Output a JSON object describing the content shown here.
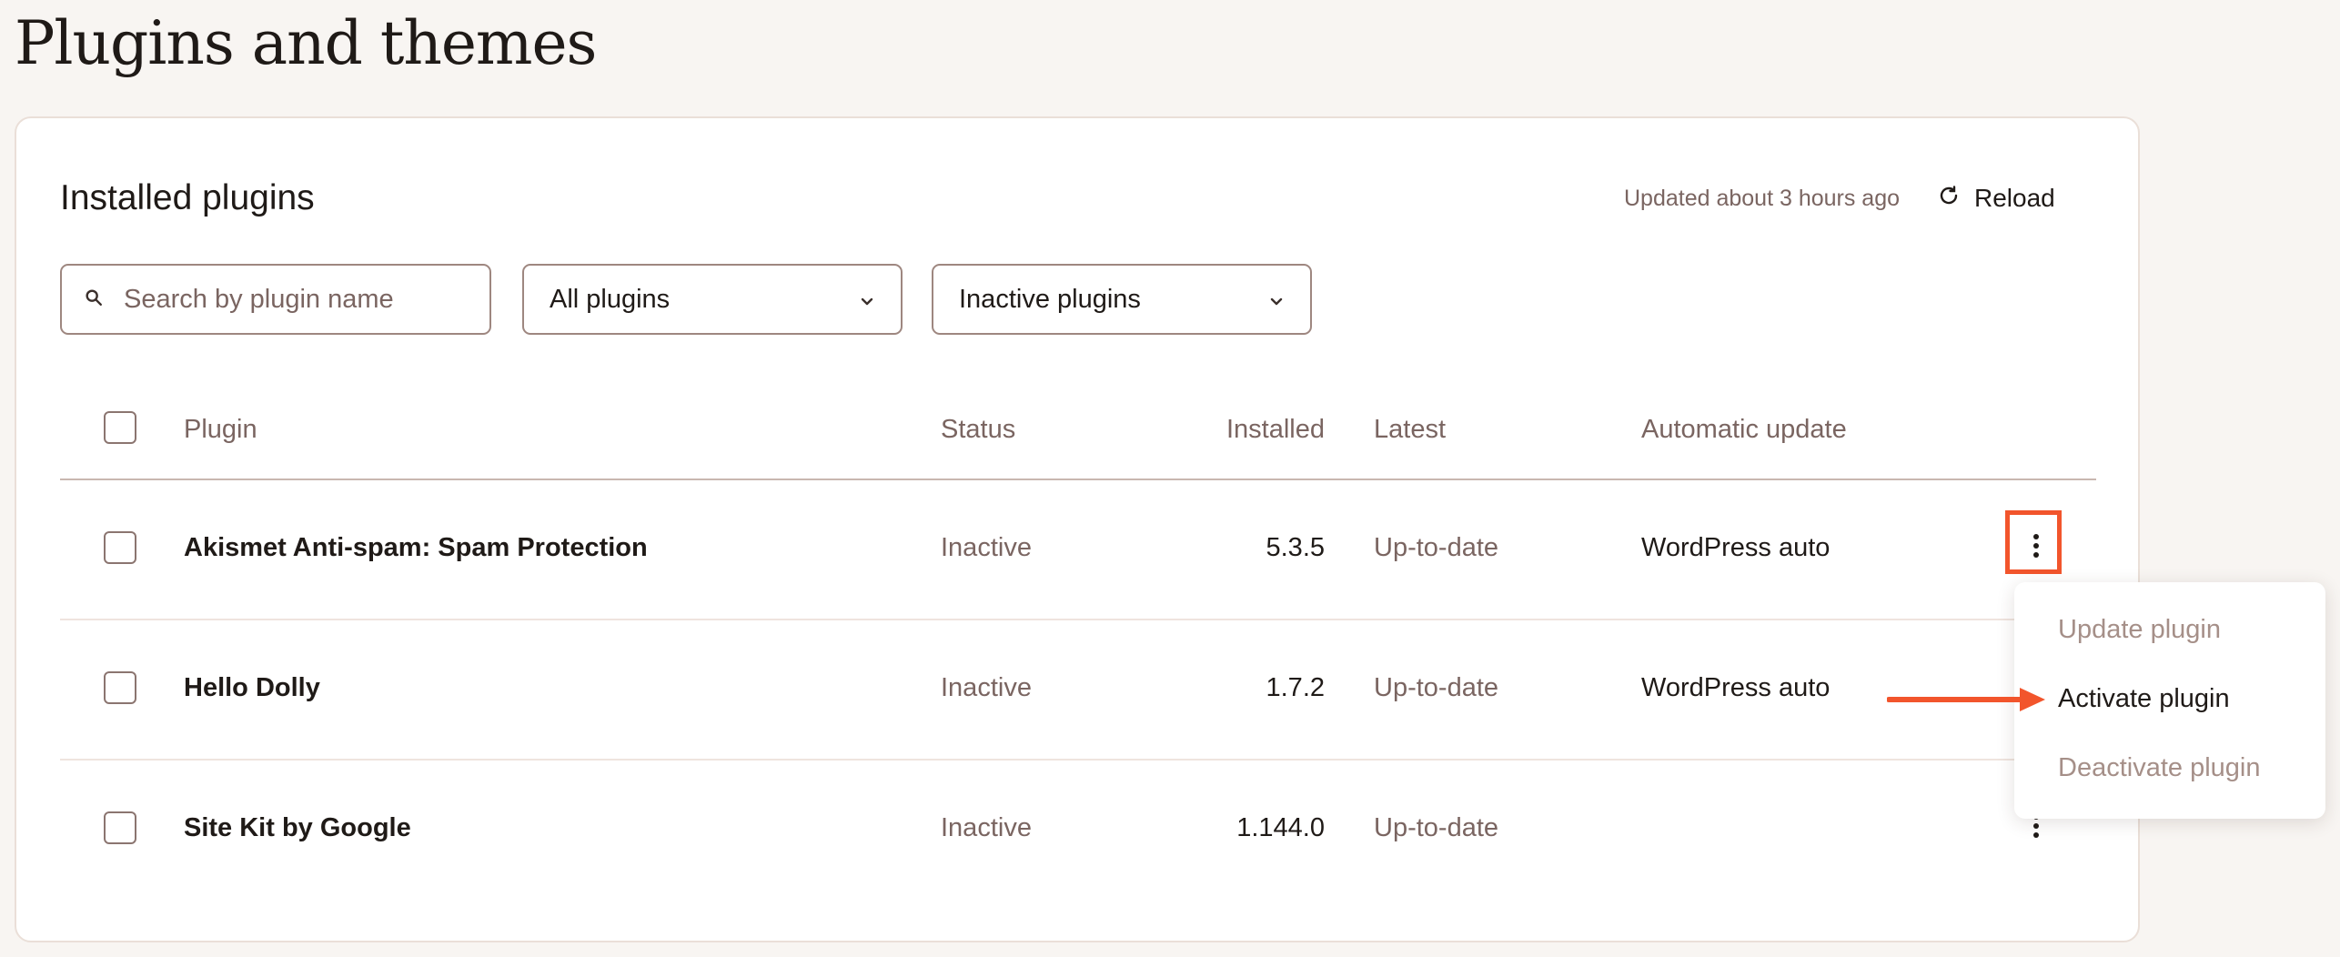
{
  "page_title": "Plugins and themes",
  "card": {
    "title": "Installed plugins",
    "updated_text": "Updated about 3 hours ago",
    "reload_label": "Reload"
  },
  "filters": {
    "search_placeholder": "Search by plugin name",
    "type_selected": "All plugins",
    "status_selected": "Inactive plugins"
  },
  "table": {
    "headers": {
      "plugin": "Plugin",
      "status": "Status",
      "installed": "Installed",
      "latest": "Latest",
      "automatic_update": "Automatic update"
    },
    "rows": [
      {
        "name": "Akismet Anti-spam: Spam Protection",
        "status": "Inactive",
        "installed": "5.3.5",
        "latest": "Up-to-date",
        "automatic_update": "WordPress auto"
      },
      {
        "name": "Hello Dolly",
        "status": "Inactive",
        "installed": "1.7.2",
        "latest": "Up-to-date",
        "automatic_update": "WordPress auto"
      },
      {
        "name": "Site Kit by Google",
        "status": "Inactive",
        "installed": "1.144.0",
        "latest": "Up-to-date",
        "automatic_update": ""
      }
    ]
  },
  "menu": {
    "items": [
      {
        "label": "Update plugin",
        "enabled": false
      },
      {
        "label": "Activate plugin",
        "enabled": true
      },
      {
        "label": "Deactivate plugin",
        "enabled": false
      }
    ]
  },
  "colors": {
    "background": "#f8f5f2",
    "accent_highlight": "#f2552c",
    "muted_text": "#7a6561",
    "border": "#9e8780"
  },
  "icons": {
    "search": "search-icon",
    "reload": "reload-icon",
    "dropdown": "chevron-down-icon",
    "more": "more-vertical-icon",
    "arrow": "arrow-right-icon"
  }
}
